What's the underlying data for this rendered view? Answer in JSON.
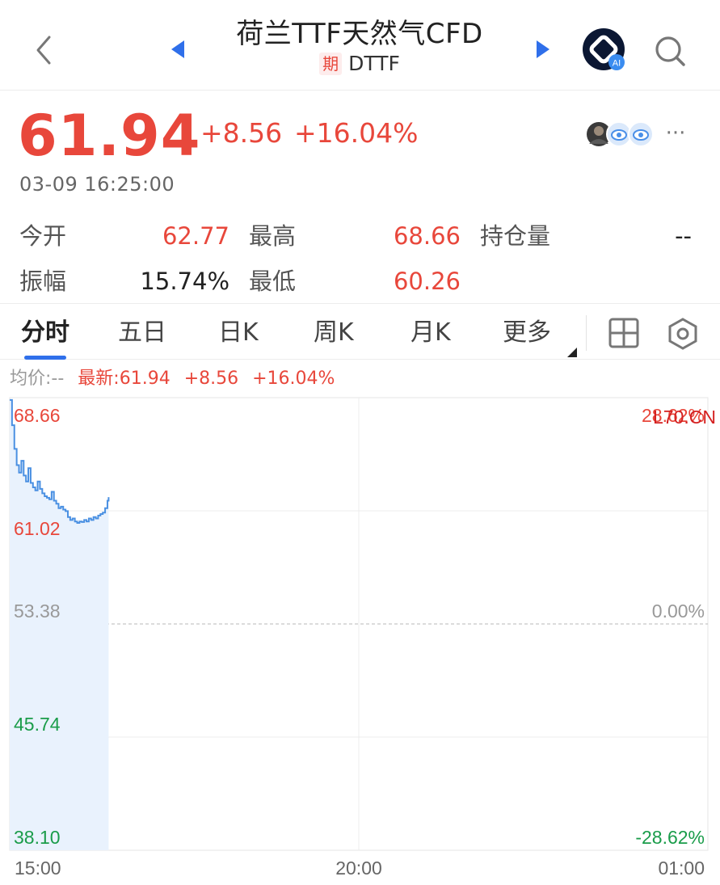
{
  "header": {
    "title": "荷兰TTF天然气CFD",
    "tag": "期",
    "code": "DTTF",
    "ai_badge": "AI",
    "icons": {
      "back": "back-chevron-icon",
      "prev": "triangle-left-icon",
      "next": "triangle-right-icon",
      "ai": "ai-assistant-icon",
      "search": "search-icon"
    }
  },
  "quote": {
    "price": "61.94",
    "change": "+8.56",
    "change_pct": "+16.04%",
    "timestamp": "03-09 16:25:00"
  },
  "stats": {
    "open_label": "今开",
    "open_value": "62.77",
    "high_label": "最高",
    "high_value": "68.66",
    "oi_label": "持仓量",
    "oi_value": "--",
    "amp_label": "振幅",
    "amp_value": "15.74%",
    "low_label": "最低",
    "low_value": "60.26"
  },
  "tabs": [
    "分时",
    "五日",
    "日K",
    "周K",
    "月K",
    "更多"
  ],
  "active_tab": "分时",
  "legend": {
    "avg": "均价:--",
    "latest": "最新:61.94",
    "change": "+8.56",
    "change_pct": "+16.04%"
  },
  "colors": {
    "up": "#e8473b",
    "down": "#1a9c4a",
    "neutral": "#999999",
    "line": "#4a90e2",
    "accent": "#2f6fea"
  },
  "chart_data": {
    "type": "line",
    "y_ticks_left": [
      "68.66",
      "61.02",
      "53.38",
      "45.74",
      "38.10"
    ],
    "y_ticks_right": [
      "28.62%",
      "",
      "0.00%",
      "",
      "-28.62%"
    ],
    "x_ticks": [
      "15:00",
      "20:00",
      "01:00"
    ],
    "ylim": [
      38.1,
      68.66
    ],
    "reference": 53.38,
    "overlay_text": "L70.CN",
    "x_minutes": [
      0,
      2,
      4,
      6,
      8,
      10,
      12,
      14,
      16,
      18,
      20,
      22,
      24,
      26,
      28,
      30,
      32,
      34,
      36,
      38,
      40,
      42,
      44,
      46,
      48,
      50,
      52,
      54,
      56,
      58,
      60,
      62,
      64,
      66,
      68,
      70,
      72,
      74,
      76,
      78,
      80,
      82,
      84,
      85
    ],
    "values": [
      68.5,
      66.8,
      65.2,
      64.1,
      63.6,
      64.4,
      63.4,
      63.0,
      63.9,
      62.9,
      62.6,
      62.4,
      63.0,
      62.5,
      62.2,
      62.0,
      61.9,
      61.8,
      62.3,
      61.7,
      61.5,
      61.2,
      61.3,
      61.1,
      61.0,
      60.6,
      60.4,
      60.5,
      60.3,
      60.2,
      60.3,
      60.26,
      60.4,
      60.3,
      60.5,
      60.4,
      60.6,
      60.5,
      60.7,
      60.8,
      60.9,
      61.2,
      61.7,
      61.94
    ],
    "total_minutes": 600,
    "grid": true
  }
}
